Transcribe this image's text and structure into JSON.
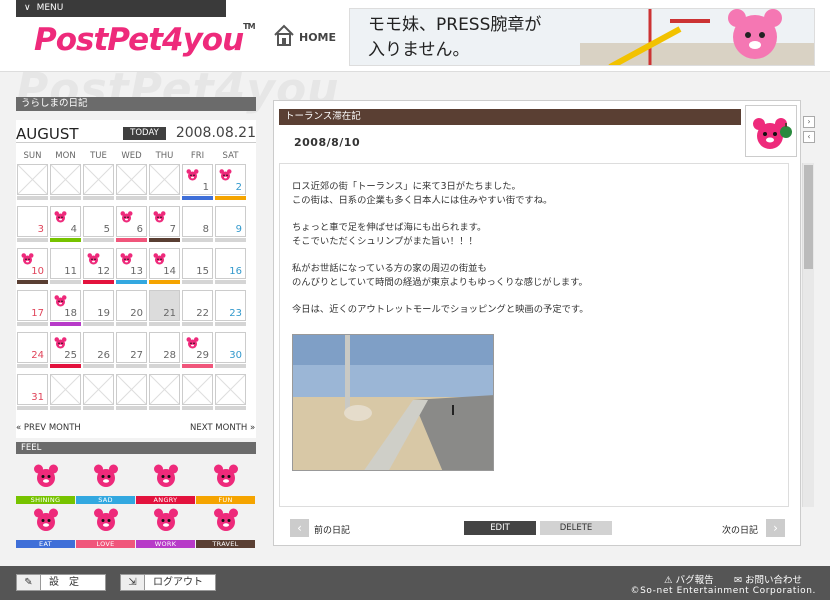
{
  "header": {
    "menu_label": "MENU",
    "logo_text": "PostPet4you",
    "logo_tm": "TM",
    "home_label": "HOME",
    "banner_line1": "モモ妹、PRESS腕章が",
    "banner_line2": "入りません。"
  },
  "watermark": "PostPet4you",
  "diary": {
    "title": "うらしまの日記",
    "month": "AUGUST",
    "today_label": "TODAY",
    "current_date": "2008.08.21",
    "weekdays": [
      "SUN",
      "MON",
      "TUE",
      "WED",
      "THU",
      "FRI",
      "SAT"
    ],
    "prev_month": "« PREV MONTH",
    "next_month": "NEXT MONTH »"
  },
  "calendar_days": [
    {
      "d": "1",
      "pet": true,
      "bar": "#3f6fd8"
    },
    {
      "d": "2",
      "pet": true,
      "bar": "#f5a400"
    },
    {
      "d": "3",
      "pet": false,
      "bar": ""
    },
    {
      "d": "4",
      "pet": true,
      "bar": "#77c300"
    },
    {
      "d": "5",
      "pet": false,
      "bar": ""
    },
    {
      "d": "6",
      "pet": true,
      "bar": "#f0567b"
    },
    {
      "d": "7",
      "pet": true,
      "bar": "#5a3f33"
    },
    {
      "d": "8",
      "pet": false,
      "bar": ""
    },
    {
      "d": "9",
      "pet": false,
      "bar": ""
    },
    {
      "d": "10",
      "pet": true,
      "bar": "#5a3f33"
    },
    {
      "d": "11",
      "pet": false,
      "bar": ""
    },
    {
      "d": "12",
      "pet": true,
      "bar": "#e3123d"
    },
    {
      "d": "13",
      "pet": true,
      "bar": "#33a8e0"
    },
    {
      "d": "14",
      "pet": true,
      "bar": "#f5a400"
    },
    {
      "d": "15",
      "pet": false,
      "bar": ""
    },
    {
      "d": "16",
      "pet": false,
      "bar": ""
    },
    {
      "d": "17",
      "pet": false,
      "bar": ""
    },
    {
      "d": "18",
      "pet": true,
      "bar": "#b73ac8"
    },
    {
      "d": "19",
      "pet": false,
      "bar": ""
    },
    {
      "d": "20",
      "pet": false,
      "bar": ""
    },
    {
      "d": "21",
      "pet": false,
      "bar": "",
      "today": true
    },
    {
      "d": "22",
      "pet": false,
      "bar": ""
    },
    {
      "d": "23",
      "pet": false,
      "bar": ""
    },
    {
      "d": "24",
      "pet": false,
      "bar": ""
    },
    {
      "d": "25",
      "pet": true,
      "bar": "#e3123d"
    },
    {
      "d": "26",
      "pet": false,
      "bar": ""
    },
    {
      "d": "27",
      "pet": false,
      "bar": ""
    },
    {
      "d": "28",
      "pet": false,
      "bar": ""
    },
    {
      "d": "29",
      "pet": true,
      "bar": "#f0567b"
    },
    {
      "d": "30",
      "pet": false,
      "bar": ""
    },
    {
      "d": "31",
      "pet": false,
      "bar": ""
    }
  ],
  "feel": {
    "title": "FEEL",
    "items": [
      {
        "label": "SHINING",
        "color": "#77c300",
        "icon": "shining-face-icon"
      },
      {
        "label": "SAD",
        "color": "#33a8e0",
        "icon": "sad-face-icon"
      },
      {
        "label": "ANGRY",
        "color": "#e3123d",
        "icon": "angry-face-icon"
      },
      {
        "label": "FUN",
        "color": "#f5a400",
        "icon": "fun-face-icon"
      },
      {
        "label": "EAT",
        "color": "#3f6fd8",
        "icon": "eat-face-icon"
      },
      {
        "label": "LOVE",
        "color": "#f0567b",
        "icon": "love-face-icon"
      },
      {
        "label": "WORK",
        "color": "#b73ac8",
        "icon": "work-face-icon"
      },
      {
        "label": "TRAVEL",
        "color": "#5a3f33",
        "icon": "travel-face-icon"
      }
    ]
  },
  "entry": {
    "title": "トーランス滞在記",
    "date": "2008/8/10",
    "lines": [
      "ロス近郊の街「トーランス」に来て3日がたちました。",
      "この街は、日系の企業も多く日本人には住みやすい街ですね。",
      "",
      "ちょっと車で足を伸ばせば海にも出られます。",
      "そこでいただくシュリンプがまた旨い！！！",
      "",
      "私がお世話になっている方の家の周辺の街並も",
      "のんびりとしていて時間の経過が東京よりもゆっくりな感じがします。",
      "",
      "今日は、近くのアウトレットモールでショッピングと映画の予定です。"
    ],
    "prev_label": "前の日記",
    "next_label": "次の日記",
    "edit_label": "EDIT",
    "delete_label": "DELETE"
  },
  "footer": {
    "settings_label": "設　定",
    "logout_label": "ログアウト",
    "bug_report": "バグ報告",
    "contact": "お問い合わせ",
    "copyright": "©So-net Entertainment Corporation."
  },
  "colors": {
    "brand_pink": "#ee2a7b",
    "header_bar": "#6b6b6b",
    "entry_bar": "#5a3f33",
    "footer_bg": "#555555"
  }
}
